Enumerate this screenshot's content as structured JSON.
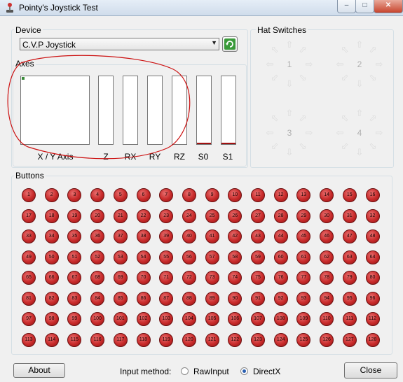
{
  "window": {
    "title": "Pointy's Joystick Test",
    "min_label": "–",
    "max_label": "□",
    "close_label": "✕"
  },
  "device": {
    "group_label": "Device",
    "selected": "C.V.P Joystick"
  },
  "axes": {
    "group_label": "Axes",
    "xy_label": "X / Y Axis",
    "bars": [
      {
        "label": "Z",
        "level": 0
      },
      {
        "label": "RX",
        "level": 0
      },
      {
        "label": "RY",
        "level": 0
      },
      {
        "label": "RZ",
        "level": 0
      },
      {
        "label": "S0",
        "level": 0.02
      },
      {
        "label": "S1",
        "level": 0.02
      }
    ]
  },
  "hats": {
    "group_label": "Hat Switches",
    "labels": [
      "1",
      "2",
      "3",
      "4"
    ]
  },
  "buttons": {
    "group_label": "Buttons",
    "labels": [
      "1",
      "2",
      "3",
      "4",
      "5",
      "6",
      "7",
      "8",
      "9",
      "10",
      "11",
      "12",
      "13",
      "14",
      "15",
      "16",
      "17",
      "18",
      "19",
      "20",
      "21",
      "22",
      "23",
      "24",
      "25",
      "26",
      "27",
      "28",
      "29",
      "30",
      "31",
      "32",
      "33",
      "34",
      "35",
      "36",
      "37",
      "38",
      "39",
      "40",
      "41",
      "42",
      "43",
      "44",
      "45",
      "46",
      "47",
      "48",
      "49",
      "50",
      "51",
      "52",
      "53",
      "54",
      "55",
      "56",
      "57",
      "58",
      "59",
      "60",
      "61",
      "62",
      "63",
      "64",
      "65",
      "66",
      "67",
      "68",
      "69",
      "70",
      "71",
      "72",
      "73",
      "74",
      "75",
      "76",
      "77",
      "78",
      "79",
      "80",
      "81",
      "82",
      "83",
      "84",
      "85",
      "86",
      "87",
      "88",
      "89",
      "90",
      "91",
      "92",
      "93",
      "94",
      "95",
      "96",
      "97",
      "98",
      "99",
      "100",
      "101",
      "102",
      "103",
      "104",
      "105",
      "106",
      "107",
      "108",
      "109",
      "110",
      "111",
      "112",
      "113",
      "114",
      "115",
      "116",
      "117",
      "118",
      "119",
      "120",
      "121",
      "122",
      "123",
      "124",
      "125",
      "126",
      "127",
      "128"
    ]
  },
  "footer": {
    "about_label": "About",
    "input_method_label": "Input method:",
    "option_rawinput": "RawInput",
    "option_directx": "DirectX",
    "selected_method": "DirectX",
    "close_label": "Close"
  },
  "colors": {
    "button_red": "#c82a2a",
    "annotation_red": "#cc1111",
    "axis_fill": "#a01010"
  }
}
